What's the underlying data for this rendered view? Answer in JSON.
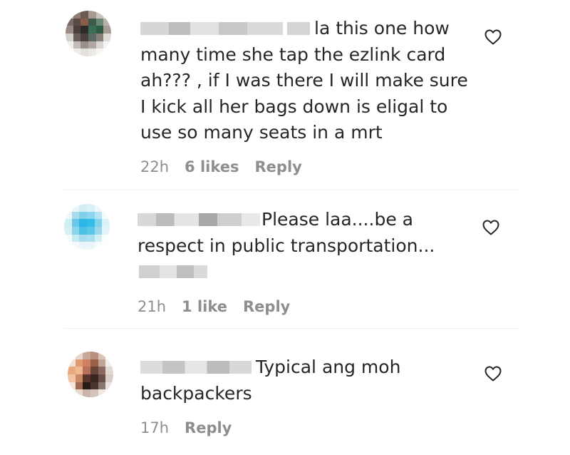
{
  "comments": [
    {
      "text": "la this one how many time she tap the ezlink card ah??? , if I was there I will make sure I kick all her bags down is eligal to use so many seats in a mrt",
      "time": "22h",
      "likes": "6 likes",
      "reply": "Reply",
      "avatar_colors": [
        "#b9b4ae",
        "#8f7d74",
        "#6b5a52",
        "#a89a92",
        "#c9c2bc",
        "#e6e1dd",
        "#7b6a62",
        "#5a4a44",
        "#8a5d4b",
        "#3f5a4b",
        "#6b8a76",
        "#b8b2ac",
        "#9a8c84",
        "#4a3f3c",
        "#2f2b2b",
        "#3b6e56",
        "#2f5a44",
        "#a59c96",
        "#d6d0cb",
        "#6a5e58",
        "#4a4242",
        "#5a6a62",
        "#8a807a",
        "#e0dcd8",
        "#f2f0ee",
        "#c4bcb6",
        "#9a908a",
        "#b0a8a2",
        "#dcd6d2",
        "#f6f4f2",
        "#ffffff",
        "#f0eeec",
        "#e4e0dc",
        "#ece8e4",
        "#f8f6f4",
        "#ffffff"
      ]
    },
    {
      "text_prefix": "Please laa....be a respect in public transportation...",
      "time": "21h",
      "likes": "1 like",
      "reply": "Reply",
      "avatar_colors": [
        "#ffffff",
        "#e8f4f8",
        "#d4eef5",
        "#d8f0f6",
        "#eef8fb",
        "#ffffff",
        "#eef8fb",
        "#a8dcec",
        "#7fd0ea",
        "#8ad6ee",
        "#b6e4f2",
        "#f2fafc",
        "#d0eef6",
        "#6cc8e6",
        "#2ab6e6",
        "#34bce8",
        "#7ed2ec",
        "#dcf2f8",
        "#d6f0f6",
        "#8cd4ea",
        "#4ac0e4",
        "#5ac6e8",
        "#9ad8ec",
        "#e2f4fa",
        "#f4fbfd",
        "#c6eaf4",
        "#a6dcee",
        "#ace0ee",
        "#d2eef6",
        "#f8fcfd",
        "#ffffff",
        "#f2fafc",
        "#e8f6fa",
        "#eaf6fa",
        "#f6fbfd",
        "#ffffff"
      ]
    },
    {
      "text": "Typical ang moh backpackers",
      "time": "17h",
      "reply": "Reply",
      "avatar_colors": [
        "#ffffff",
        "#e8d6cc",
        "#c8a898",
        "#b89080",
        "#d8c4b8",
        "#ffffff",
        "#f0e0d6",
        "#e09a70",
        "#d08060",
        "#9a6048",
        "#c2a496",
        "#f4ece8",
        "#e8a882",
        "#f0b890",
        "#b87058",
        "#6a4438",
        "#8a6a5e",
        "#e4d8d2",
        "#f2c4a4",
        "#c88a64",
        "#5a3428",
        "#3a2420",
        "#6a5048",
        "#d8ccc6",
        "#f4e4da",
        "#a06a50",
        "#2a1a16",
        "#4a3430",
        "#8a7870",
        "#ece4e0",
        "#ffffff",
        "#e8d8ce",
        "#c8b4aa",
        "#d4c4bc",
        "#f0e8e4",
        "#ffffff"
      ]
    }
  ],
  "redaction_color": "#cfcfcf"
}
